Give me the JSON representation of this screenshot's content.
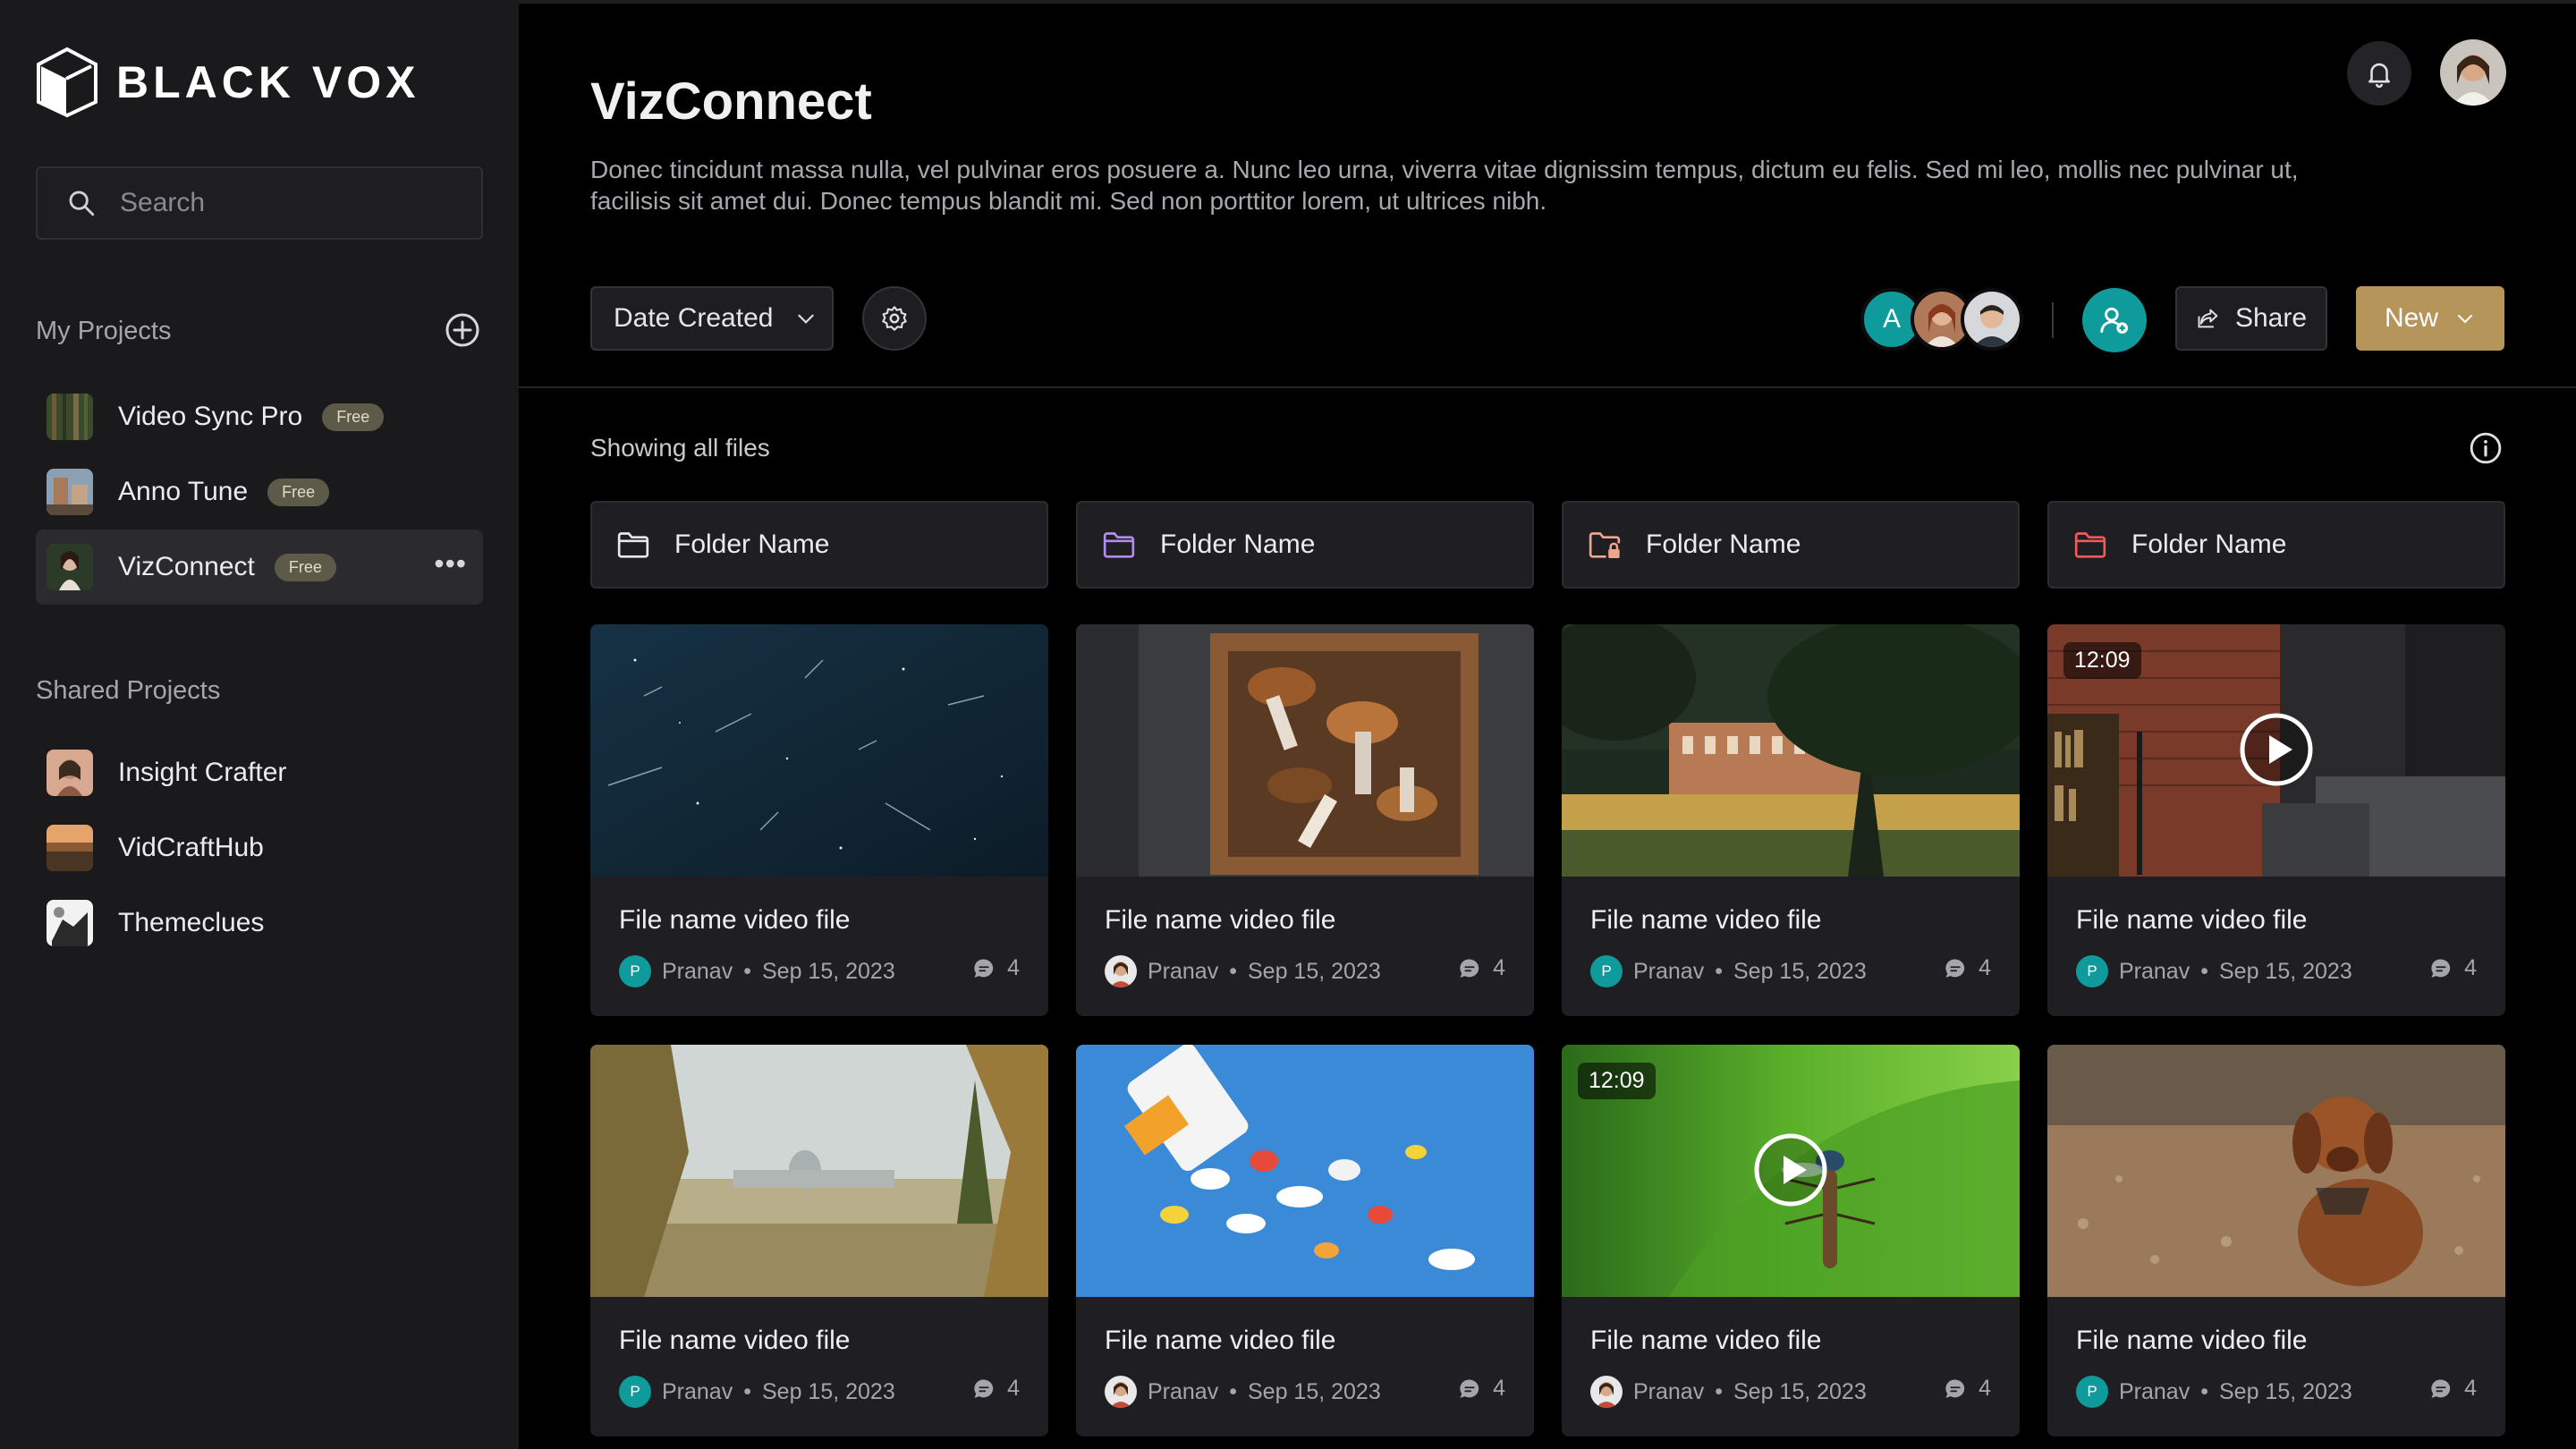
{
  "app": {
    "brand": "BLACK VOX"
  },
  "search": {
    "placeholder": "Search"
  },
  "sidebar": {
    "my_projects_title": "My Projects",
    "my_projects": [
      {
        "name": "Video Sync Pro",
        "badge": "Free"
      },
      {
        "name": "Anno Tune",
        "badge": "Free"
      },
      {
        "name": "VizConnect",
        "badge": "Free",
        "active": true
      }
    ],
    "shared_projects_title": "Shared Projects",
    "shared_projects": [
      {
        "name": "Insight Crafter"
      },
      {
        "name": "VidCraftHub"
      },
      {
        "name": "Themeclues"
      }
    ]
  },
  "header": {
    "title": "VizConnect",
    "description": "Donec tincidunt massa nulla, vel pulvinar eros posuere a. Nunc leo urna, viverra vitae dignissim tempus, dictum eu felis. Sed mi leo, mollis nec pulvinar ut, facilisis sit amet dui. Donec tempus blandit mi. Sed non porttitor lorem, ut ultrices nibh."
  },
  "toolbar": {
    "sort_label": "Date Created",
    "collaborator_initial": "A",
    "share_label": "Share",
    "new_label": "New"
  },
  "files_header": {
    "showing": "Showing all files"
  },
  "folders": [
    {
      "name": "Folder Name",
      "icon": "folder-icon",
      "color": "#e8e8ea"
    },
    {
      "name": "Folder Name",
      "icon": "folder-icon",
      "color": "#b48cf0"
    },
    {
      "name": "Folder Name",
      "icon": "locked-folder-icon",
      "color": "#f0a58c"
    },
    {
      "name": "Folder Name",
      "icon": "folder-icon",
      "color": "#f05a5a"
    }
  ],
  "files": [
    {
      "name": "File name video file",
      "author": "Pranav",
      "date": "Sep 15, 2023",
      "comments": "4",
      "avatar_initial": "P"
    },
    {
      "name": "File name video file",
      "author": "Pranav",
      "date": "Sep 15, 2023",
      "comments": "4"
    },
    {
      "name": "File name video file",
      "author": "Pranav",
      "date": "Sep 15, 2023",
      "comments": "4",
      "avatar_initial": "P"
    },
    {
      "name": "File name video file",
      "author": "Pranav",
      "date": "Sep 15, 2023",
      "comments": "4",
      "avatar_initial": "P",
      "duration": "12:09"
    },
    {
      "name": "File name video file",
      "author": "Pranav",
      "date": "Sep 15, 2023",
      "comments": "4",
      "avatar_initial": "P"
    },
    {
      "name": "File name video file",
      "author": "Pranav",
      "date": "Sep 15, 2023",
      "comments": "4"
    },
    {
      "name": "File name video file",
      "author": "Pranav",
      "date": "Sep 15, 2023",
      "comments": "4",
      "duration": "12:09"
    },
    {
      "name": "File name video file",
      "author": "Pranav",
      "date": "Sep 15, 2023",
      "comments": "4",
      "avatar_initial": "P"
    }
  ],
  "meta_separator": "•",
  "colors": {
    "accent_teal": "#0f9a9b",
    "accent_gold": "#b6955a",
    "sidebar_bg": "#1a1a1d",
    "main_bg": "#000000"
  }
}
